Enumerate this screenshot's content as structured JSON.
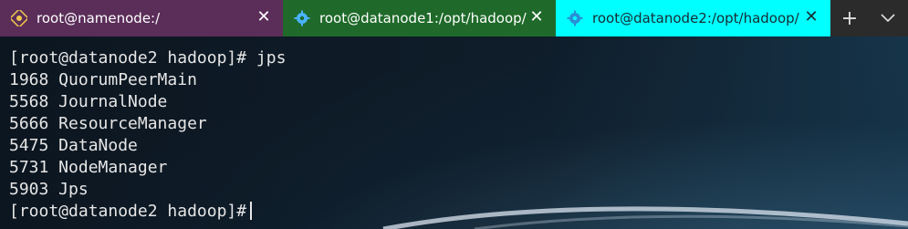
{
  "tabs": [
    {
      "label": "root@namenode:/",
      "icon": "linux-penguin-icon",
      "color": "#5b2e5a"
    },
    {
      "label": "root@datanode1:/opt/hadoop/",
      "icon": "gear-icon",
      "color": "#1f6a2a"
    },
    {
      "label": "root@datanode2:/opt/hadoop/",
      "icon": "gear-icon",
      "color": "#00ffff"
    }
  ],
  "tabbar": {
    "new_tab": "+",
    "dropdown": "⌄",
    "close": "✕"
  },
  "terminal": {
    "lines": [
      "[root@datanode2 hadoop]# jps",
      "1968 QuorumPeerMain",
      "5568 JournalNode",
      "5666 ResourceManager",
      "5475 DataNode",
      "5731 NodeManager",
      "5903 Jps",
      "[root@datanode2 hadoop]#"
    ]
  }
}
